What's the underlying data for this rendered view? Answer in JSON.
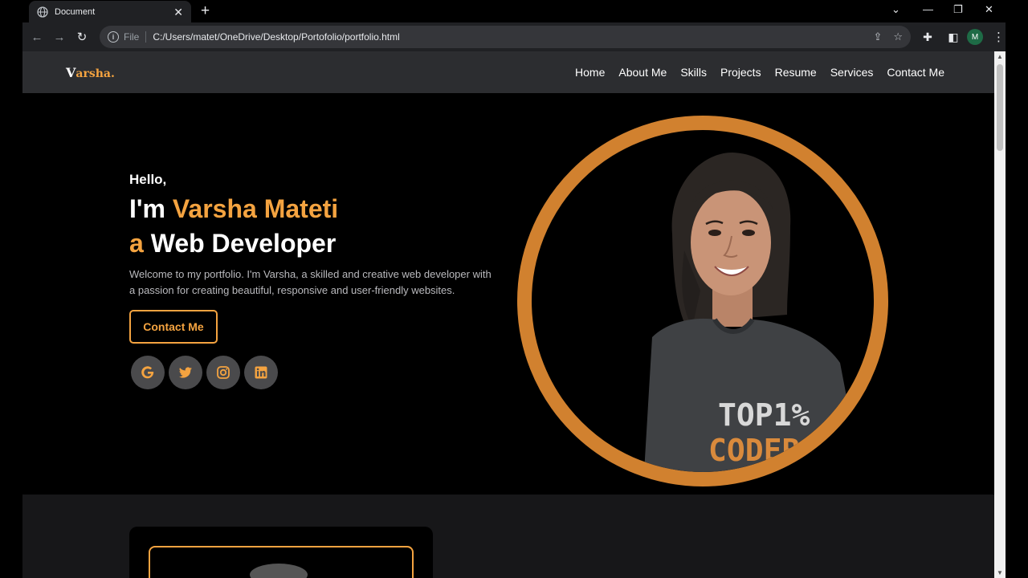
{
  "browser": {
    "tab_title": "Document",
    "url_scheme": "File",
    "url": "C:/Users/matet/OneDrive/Desktop/Portofolio/portfolio.html",
    "profile_initial": "M"
  },
  "site": {
    "logo_first": "V",
    "logo_rest": "arsha.",
    "nav": [
      "Home",
      "About Me",
      "Skills",
      "Projects",
      "Resume",
      "Services",
      "Contact Me"
    ]
  },
  "hero": {
    "greeting": "Hello,",
    "intro_prefix": "I'm",
    "name": "Varsha Mateti",
    "role_article": "a",
    "role": "Web Developer",
    "description": "Welcome to my portfolio. I'm Varsha, a skilled and creative web developer with a passion for creating beautiful, responsive and user-friendly websites.",
    "button": "Contact Me",
    "socials": [
      "google-icon",
      "twitter-icon",
      "instagram-icon",
      "linkedin-icon"
    ],
    "shirt_text_1": "TOP1%",
    "shirt_text_2": "CODER"
  },
  "colors": {
    "accent": "#f4a340",
    "ring": "#d1812f",
    "nav_bg": "#2c2d30",
    "section_bg": "#171719"
  }
}
